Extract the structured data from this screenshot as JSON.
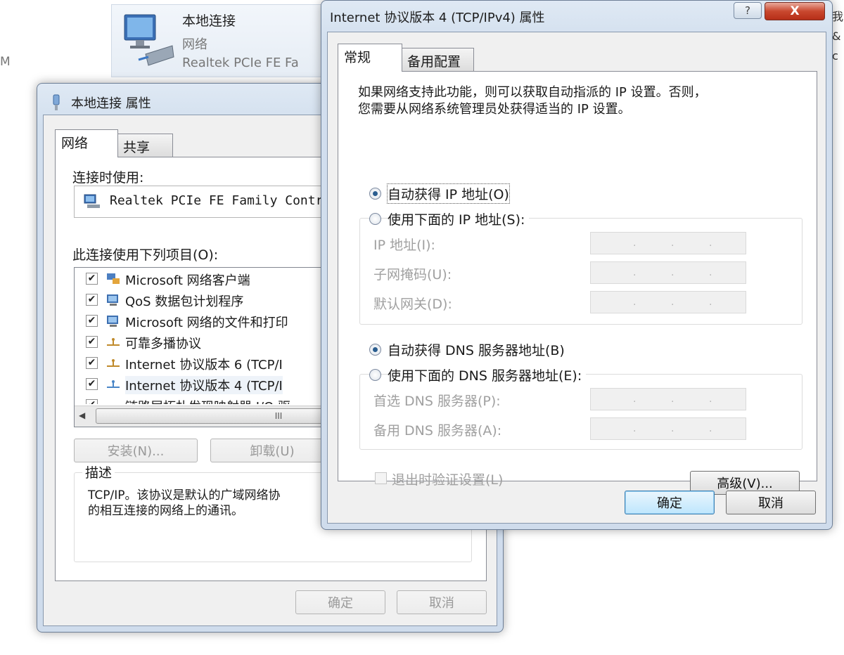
{
  "background": {
    "tile_title": "本地连接",
    "tile_subtitle": "网络",
    "tile_adapter": "Realtek PCIe FE Fa",
    "left_edge_text": "M",
    "right_edge_text": "我 & c"
  },
  "props_window": {
    "title": "本地连接 属性",
    "tabs": [
      "网络",
      "共享"
    ],
    "connect_using_label": "连接时使用:",
    "adapter_name": "Realtek PCIe FE Family Contr",
    "items_label": "此连接使用下列项目(O):",
    "items": [
      {
        "label": "Microsoft 网络客户端",
        "checked": true,
        "icon": "network-client-icon"
      },
      {
        "label": "QoS 数据包计划程序",
        "checked": true,
        "icon": "qos-service-icon"
      },
      {
        "label": "Microsoft 网络的文件和打印",
        "checked": true,
        "icon": "file-print-service-icon"
      },
      {
        "label": "可靠多播协议",
        "checked": true,
        "icon": "protocol-icon"
      },
      {
        "label": "Internet 协议版本 6 (TCP/I",
        "checked": true,
        "icon": "protocol-icon"
      },
      {
        "label": "Internet 协议版本 4 (TCP/I",
        "checked": true,
        "icon": "protocol-icon"
      },
      {
        "label": "链路层拓扑发现映射器 I/O 驱",
        "checked": true,
        "icon": "protocol-icon"
      }
    ],
    "scroll_thumb_glyph": "III",
    "install_button": "安装(N)...",
    "uninstall_button": "卸载(U)",
    "description_legend": "描述",
    "description_text": "TCP/IP。该协议是默认的广域网络协议，它提供在不同的相互连接的网络上的通讯。",
    "description_line1": "TCP/IP。该协议是默认的广域网络协",
    "description_line2": "的相互连接的网络上的通讯。",
    "ok_button": "确定",
    "cancel_button": "取消"
  },
  "ipv4_dialog": {
    "title": "Internet 协议版本 4 (TCP/IPv4) 属性",
    "help_glyph": "?",
    "close_glyph": "X",
    "tabs": [
      "常规",
      "备用配置"
    ],
    "intro_line1": "如果网络支持此功能，则可以获取自动指派的 IP 设置。否则，",
    "intro_line2": "您需要从网络系统管理员处获得适当的 IP 设置。",
    "auto_ip": "自动获得 IP 地址(O)",
    "manual_ip": "使用下面的 IP 地址(S):",
    "ip_address_label": "IP 地址(I):",
    "subnet_label": "子网掩码(U):",
    "gateway_label": "默认网关(D):",
    "auto_dns": "自动获得 DNS 服务器地址(B)",
    "manual_dns": "使用下面的 DNS 服务器地址(E):",
    "preferred_dns_label": "首选 DNS 服务器(P):",
    "alternate_dns_label": "备用 DNS 服务器(A):",
    "ip_dot": ".",
    "validate_on_exit": "退出时验证设置(L)",
    "validate_checked": false,
    "ip_mode": "automatic",
    "dns_mode": "automatic",
    "advanced_button": "高级(V)...",
    "ok_button": "确定",
    "cancel_button": "取消"
  },
  "colors": {
    "title_bar": "#d2dfee",
    "client_bg": "#f0f0f0",
    "close_red": "#c9482f",
    "default_button": "#bee6fd",
    "disabled_text": "#a0a0a0"
  }
}
